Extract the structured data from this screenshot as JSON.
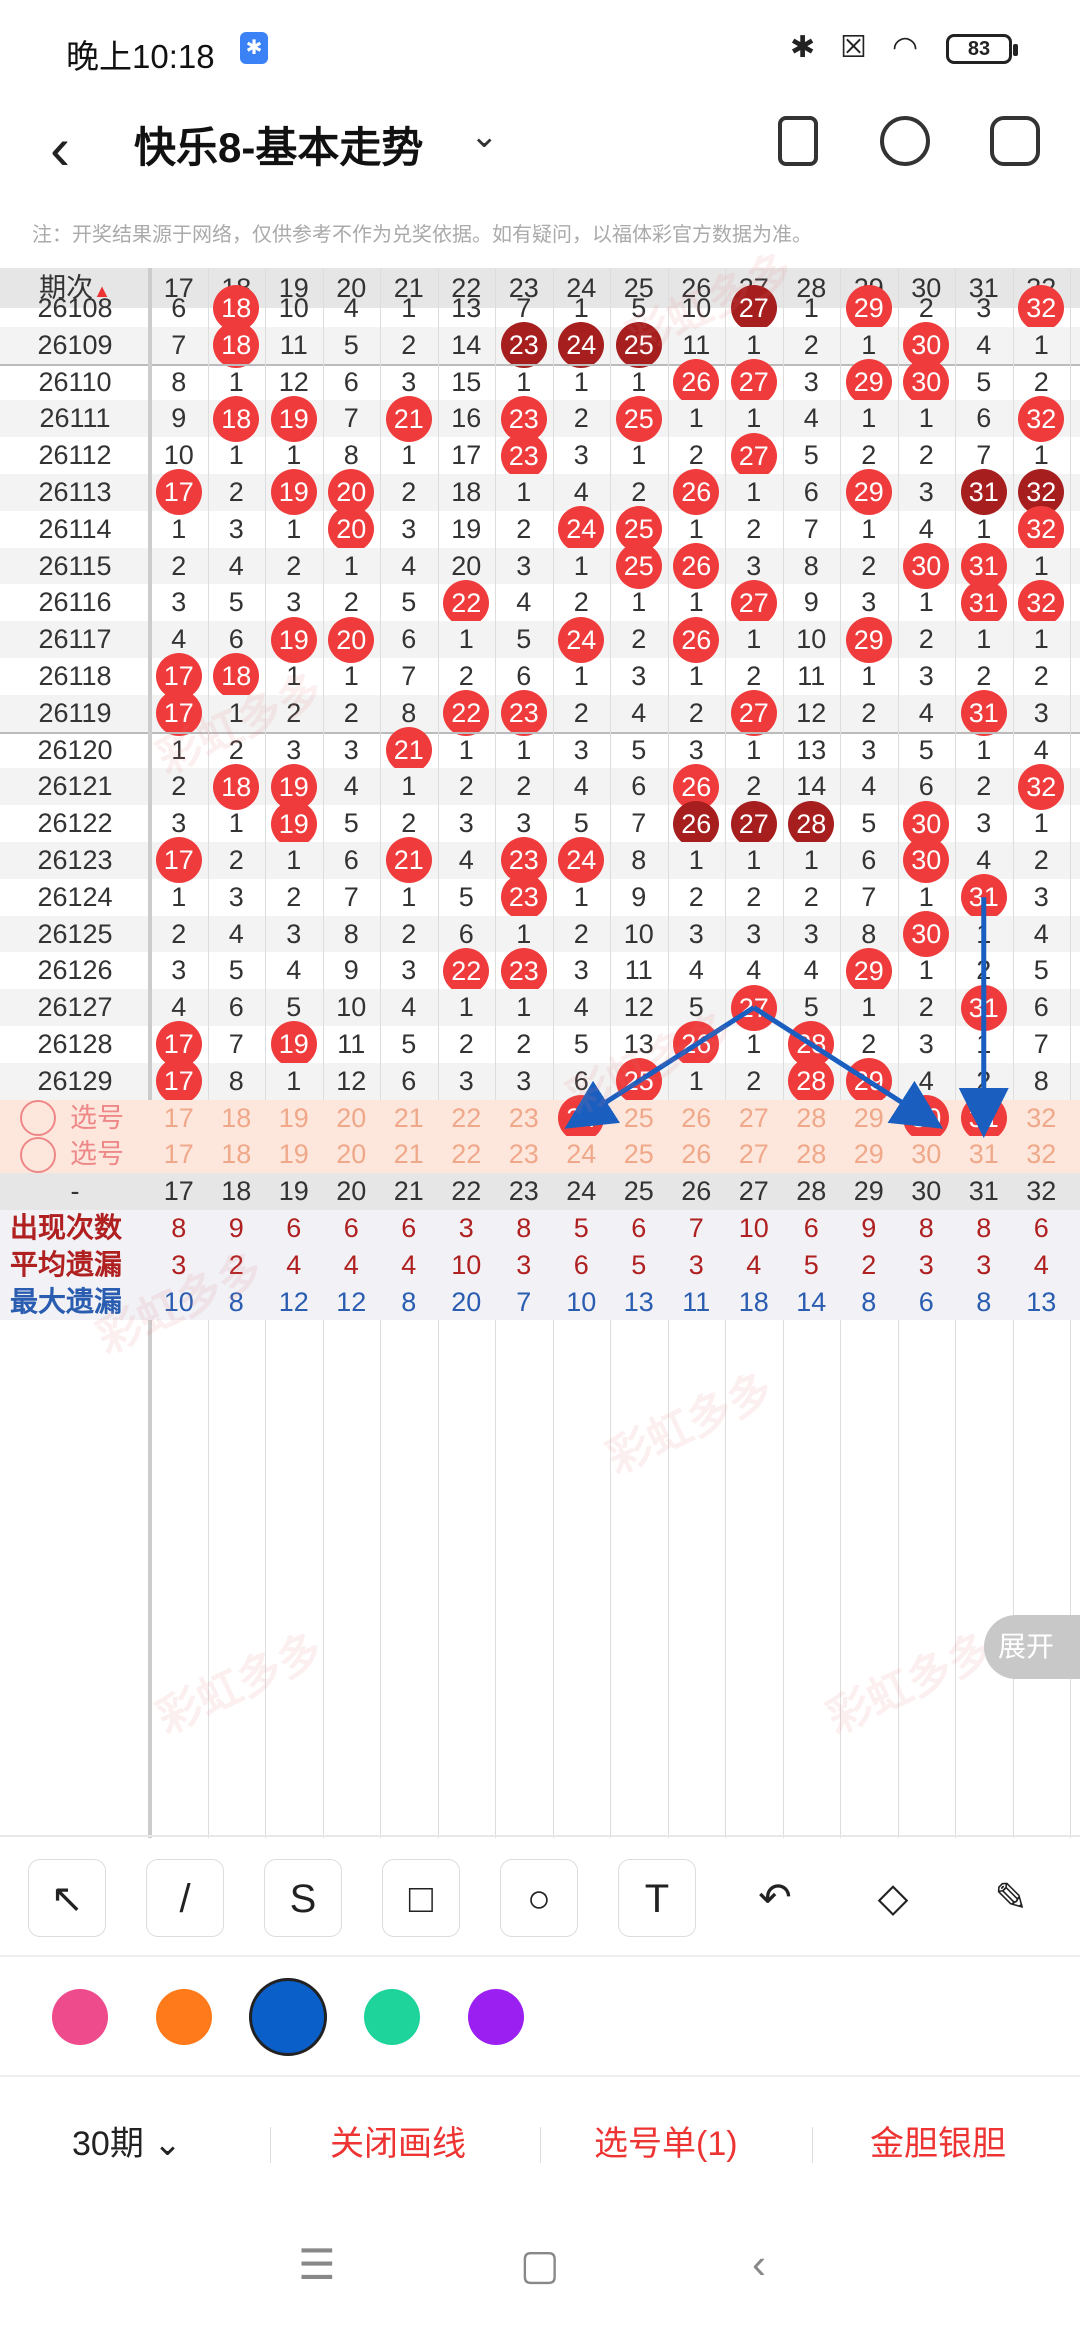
{
  "status": {
    "time": "晚上10:18",
    "bt_badge": "✱",
    "battery": "83"
  },
  "appbar": {
    "title": "快乐8-基本走势"
  },
  "note": "注：开奖结果源于网络，仅供参考不作为兑奖依据。如有疑问，以福体彩官方数据为准。",
  "table": {
    "period_header": "期次",
    "columns": [
      "17",
      "18",
      "19",
      "20",
      "21",
      "22",
      "23",
      "24",
      "25",
      "26",
      "27",
      "28",
      "29",
      "30",
      "31",
      "32"
    ],
    "rows": [
      {
        "period": "26108",
        "cells": [
          "6",
          "18",
          "10",
          "4",
          "1",
          "13",
          "7",
          "1",
          "5",
          "10",
          "27",
          "1",
          "29",
          "2",
          "3",
          "32"
        ],
        "balls": [
          1,
          10,
          12,
          15
        ],
        "dark": [
          10
        ]
      },
      {
        "period": "26109",
        "cells": [
          "7",
          "18",
          "11",
          "5",
          "2",
          "14",
          "23",
          "24",
          "25",
          "11",
          "1",
          "2",
          "1",
          "30",
          "4",
          "1"
        ],
        "balls": [
          1,
          6,
          7,
          8,
          13
        ],
        "dark": [
          6,
          7,
          8
        ]
      },
      {
        "period": "26110",
        "cells": [
          "8",
          "1",
          "12",
          "6",
          "3",
          "15",
          "1",
          "1",
          "1",
          "26",
          "27",
          "3",
          "29",
          "30",
          "5",
          "2"
        ],
        "balls": [
          9,
          10,
          12,
          13
        ],
        "dark": []
      },
      {
        "period": "26111",
        "cells": [
          "9",
          "18",
          "19",
          "7",
          "21",
          "16",
          "23",
          "2",
          "25",
          "1",
          "1",
          "4",
          "1",
          "1",
          "6",
          "32"
        ],
        "balls": [
          1,
          2,
          4,
          6,
          8,
          15
        ],
        "dark": []
      },
      {
        "period": "26112",
        "cells": [
          "10",
          "1",
          "1",
          "8",
          "1",
          "17",
          "23",
          "3",
          "1",
          "2",
          "27",
          "5",
          "2",
          "2",
          "7",
          "1"
        ],
        "balls": [
          6,
          10
        ],
        "dark": []
      },
      {
        "period": "26113",
        "cells": [
          "17",
          "2",
          "19",
          "20",
          "2",
          "18",
          "1",
          "4",
          "2",
          "26",
          "1",
          "6",
          "29",
          "3",
          "31",
          "32"
        ],
        "balls": [
          0,
          2,
          3,
          9,
          12,
          14,
          15
        ],
        "dark": [
          14,
          15
        ]
      },
      {
        "period": "26114",
        "cells": [
          "1",
          "3",
          "1",
          "20",
          "3",
          "19",
          "2",
          "24",
          "25",
          "1",
          "2",
          "7",
          "1",
          "4",
          "1",
          "32"
        ],
        "balls": [
          3,
          7,
          8,
          15
        ],
        "dark": []
      },
      {
        "period": "26115",
        "cells": [
          "2",
          "4",
          "2",
          "1",
          "4",
          "20",
          "3",
          "1",
          "25",
          "26",
          "3",
          "8",
          "2",
          "30",
          "31",
          "1"
        ],
        "balls": [
          8,
          9,
          13,
          14
        ],
        "dark": []
      },
      {
        "period": "26116",
        "cells": [
          "3",
          "5",
          "3",
          "2",
          "5",
          "22",
          "4",
          "2",
          "1",
          "1",
          "27",
          "9",
          "3",
          "1",
          "31",
          "32"
        ],
        "balls": [
          5,
          10,
          14,
          15
        ],
        "dark": []
      },
      {
        "period": "26117",
        "cells": [
          "4",
          "6",
          "19",
          "20",
          "6",
          "1",
          "5",
          "24",
          "2",
          "26",
          "1",
          "10",
          "29",
          "2",
          "1",
          "1"
        ],
        "balls": [
          2,
          3,
          7,
          9,
          12
        ],
        "dark": []
      },
      {
        "period": "26118",
        "cells": [
          "17",
          "18",
          "1",
          "1",
          "7",
          "2",
          "6",
          "1",
          "3",
          "1",
          "2",
          "11",
          "1",
          "3",
          "2",
          "2"
        ],
        "balls": [
          0,
          1
        ],
        "dark": []
      },
      {
        "period": "26119",
        "cells": [
          "17",
          "1",
          "2",
          "2",
          "8",
          "22",
          "23",
          "2",
          "4",
          "2",
          "27",
          "12",
          "2",
          "4",
          "31",
          "3"
        ],
        "balls": [
          0,
          5,
          6,
          10,
          14
        ],
        "dark": []
      },
      {
        "period": "26120",
        "cells": [
          "1",
          "2",
          "3",
          "3",
          "21",
          "1",
          "1",
          "3",
          "5",
          "3",
          "1",
          "13",
          "3",
          "5",
          "1",
          "4"
        ],
        "balls": [
          4
        ],
        "dark": []
      },
      {
        "period": "26121",
        "cells": [
          "2",
          "18",
          "19",
          "4",
          "1",
          "2",
          "2",
          "4",
          "6",
          "26",
          "2",
          "14",
          "4",
          "6",
          "2",
          "32"
        ],
        "balls": [
          1,
          2,
          9,
          15
        ],
        "dark": []
      },
      {
        "period": "26122",
        "cells": [
          "3",
          "1",
          "19",
          "5",
          "2",
          "3",
          "3",
          "5",
          "7",
          "26",
          "27",
          "28",
          "5",
          "30",
          "3",
          "1"
        ],
        "balls": [
          2,
          9,
          10,
          11,
          13
        ],
        "dark": [
          9,
          10,
          11
        ]
      },
      {
        "period": "26123",
        "cells": [
          "17",
          "2",
          "1",
          "6",
          "21",
          "4",
          "23",
          "24",
          "8",
          "1",
          "1",
          "1",
          "6",
          "30",
          "4",
          "2"
        ],
        "balls": [
          0,
          4,
          6,
          7,
          13
        ],
        "dark": []
      },
      {
        "period": "26124",
        "cells": [
          "1",
          "3",
          "2",
          "7",
          "1",
          "5",
          "23",
          "1",
          "9",
          "2",
          "2",
          "2",
          "7",
          "1",
          "31",
          "3"
        ],
        "balls": [
          6,
          14
        ],
        "dark": []
      },
      {
        "period": "26125",
        "cells": [
          "2",
          "4",
          "3",
          "8",
          "2",
          "6",
          "1",
          "2",
          "10",
          "3",
          "3",
          "3",
          "8",
          "30",
          "1",
          "4"
        ],
        "balls": [
          13
        ],
        "dark": []
      },
      {
        "period": "26126",
        "cells": [
          "3",
          "5",
          "4",
          "9",
          "3",
          "22",
          "23",
          "3",
          "11",
          "4",
          "4",
          "4",
          "29",
          "1",
          "2",
          "5"
        ],
        "balls": [
          5,
          6,
          12
        ],
        "dark": []
      },
      {
        "period": "26127",
        "cells": [
          "4",
          "6",
          "5",
          "10",
          "4",
          "1",
          "1",
          "4",
          "12",
          "5",
          "27",
          "5",
          "1",
          "2",
          "31",
          "6"
        ],
        "balls": [
          10,
          14
        ],
        "dark": []
      },
      {
        "period": "26128",
        "cells": [
          "17",
          "7",
          "19",
          "11",
          "5",
          "2",
          "2",
          "5",
          "13",
          "26",
          "1",
          "28",
          "2",
          "3",
          "1",
          "7"
        ],
        "balls": [
          0,
          2,
          9,
          11
        ],
        "dark": []
      },
      {
        "period": "26129",
        "cells": [
          "17",
          "8",
          "1",
          "12",
          "6",
          "3",
          "3",
          "6",
          "25",
          "1",
          "2",
          "28",
          "29",
          "4",
          "2",
          "8"
        ],
        "balls": [
          0,
          8,
          11,
          12
        ],
        "dark": []
      }
    ],
    "pick_label": "选号",
    "pick_rows": [
      {
        "balls": [
          7,
          13,
          14
        ]
      },
      {
        "balls": []
      }
    ],
    "footer_dash": "-",
    "stats": [
      {
        "label": "出现次数",
        "color": "#b02020",
        "values": [
          "8",
          "9",
          "6",
          "6",
          "6",
          "3",
          "8",
          "5",
          "6",
          "7",
          "10",
          "6",
          "9",
          "8",
          "8",
          "6"
        ]
      },
      {
        "label": "平均遗漏",
        "color": "#b02020",
        "values": [
          "3",
          "2",
          "4",
          "4",
          "4",
          "10",
          "3",
          "6",
          "5",
          "3",
          "4",
          "5",
          "2",
          "3",
          "3",
          "4"
        ]
      },
      {
        "label": "最大遗漏",
        "color": "#2a5db0",
        "values": [
          "10",
          "8",
          "12",
          "12",
          "8",
          "20",
          "7",
          "10",
          "13",
          "11",
          "18",
          "14",
          "8",
          "6",
          "8",
          "13"
        ]
      }
    ],
    "expand_label": "展开"
  },
  "tools": [
    "↖",
    "/",
    "S",
    "□",
    "○",
    "T",
    "↶",
    "◇",
    "✎"
  ],
  "colors": [
    "#ee4b8c",
    "#ff7a1a",
    "#0b5fc9",
    "#1ed49a",
    "#9b1ff0"
  ],
  "bottom": {
    "period_select": "30期",
    "close_lines": "关闭画线",
    "pick_list": "选号单(1)",
    "gold_silver": "金胆银胆"
  },
  "watermark": "彩虹多多"
}
